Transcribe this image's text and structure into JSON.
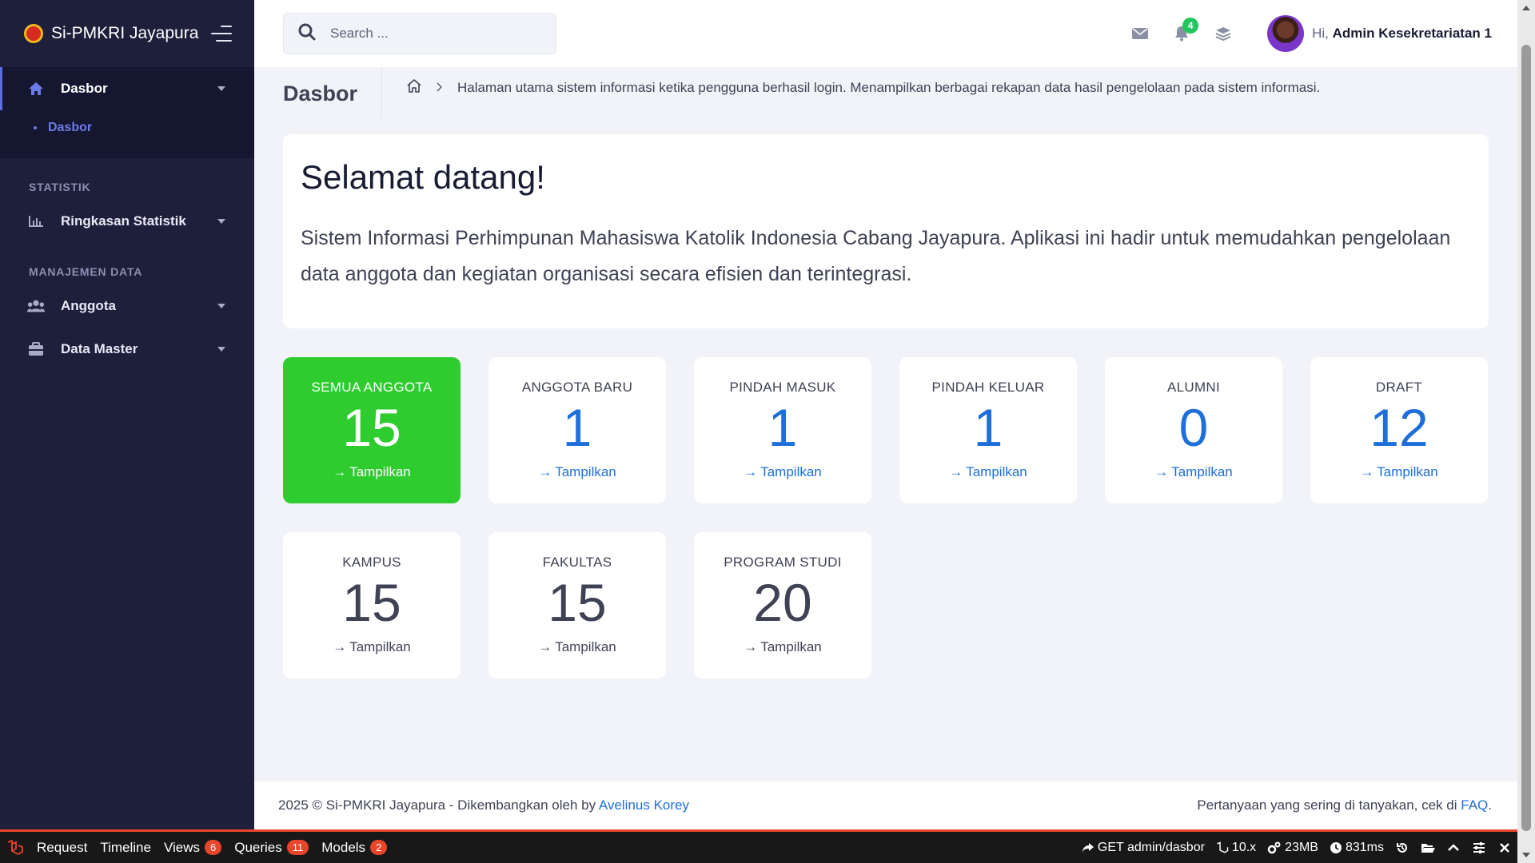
{
  "sidebar": {
    "brand": "Si-PMKRI Jayapura",
    "dasbor_label": "Dasbor",
    "dasbor_sub": "Dasbor",
    "section_statistik": "STATISTIK",
    "ringkasan_label": "Ringkasan Statistik",
    "section_manajemen": "MANAJEMEN DATA",
    "anggota_label": "Anggota",
    "datamaster_label": "Data Master"
  },
  "topbar": {
    "search_placeholder": "Search ...",
    "notif_count": "4",
    "greeting": "Hi,",
    "user_name": "Admin Kesekretariatan 1"
  },
  "subheader": {
    "title": "Dasbor",
    "breadcrumb": "Halaman utama sistem informasi ketika pengguna berhasil login. Menampilkan berbagai rekapan data hasil pengelolaan pada sistem informasi."
  },
  "welcome": {
    "heading": "Selamat datang!",
    "text": "Sistem Informasi Perhimpunan Mahasiswa Katolik Indonesia Cabang Jayapura. Aplikasi ini hadir untuk memudahkan pengelolaan data anggota dan kegiatan organisasi secara efisien dan terintegrasi."
  },
  "stats": [
    {
      "label": "SEMUA ANGGOTA",
      "value": "15",
      "link": "Tampilkan"
    },
    {
      "label": "ANGGOTA BARU",
      "value": "1",
      "link": "Tampilkan"
    },
    {
      "label": "PINDAH MASUK",
      "value": "1",
      "link": "Tampilkan"
    },
    {
      "label": "PINDAH KELUAR",
      "value": "1",
      "link": "Tampilkan"
    },
    {
      "label": "ALUMNI",
      "value": "0",
      "link": "Tampilkan"
    },
    {
      "label": "DRAFT",
      "value": "12",
      "link": "Tampilkan"
    },
    {
      "label": "KAMPUS",
      "value": "15",
      "link": "Tampilkan"
    },
    {
      "label": "FAKULTAS",
      "value": "15",
      "link": "Tampilkan"
    },
    {
      "label": "PROGRAM STUDI",
      "value": "20",
      "link": "Tampilkan"
    }
  ],
  "footer": {
    "left_text": "2025 © Si-PMKRI Jayapura - Dikembangkan oleh by",
    "left_link": "Avelinus Korey",
    "right_text": "Pertanyaan yang sering di tanyakan, cek di",
    "right_link": "FAQ",
    "right_end": "."
  },
  "debugbar": {
    "tabs": [
      {
        "label": "Request",
        "count": ""
      },
      {
        "label": "Timeline",
        "count": ""
      },
      {
        "label": "Views",
        "count": "6"
      },
      {
        "label": "Queries",
        "count": "11"
      },
      {
        "label": "Models",
        "count": "2"
      }
    ],
    "route": "GET admin/dasbor",
    "version": "10.x",
    "memory": "23MB",
    "time": "831ms"
  },
  "colors": {
    "sidebar_bg": "#1e1f3b",
    "accent_blue": "#1e6fd9",
    "green_card": "#2ecc2e",
    "badge_green": "#22c55e",
    "debug_red": "#e8452c"
  }
}
